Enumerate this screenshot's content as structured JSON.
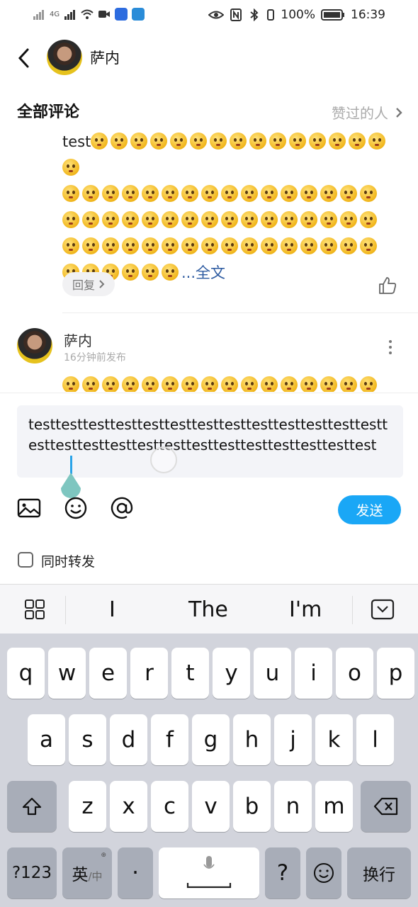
{
  "status_bar": {
    "signal_left": "4G",
    "battery": "100%",
    "time": "16:39"
  },
  "header": {
    "name": "萨内",
    "back_icon": "chevron-left-icon"
  },
  "comments_section": {
    "title": "全部评论",
    "likers_link": "赞过的人"
  },
  "comment1": {
    "text_start": "test",
    "emoji_count_line1": 16,
    "emoji_count_lines": [
      16,
      16,
      16,
      6
    ],
    "full_text_link": "...全文",
    "reply_label": "回复"
  },
  "comment2": {
    "name": "萨内",
    "time": "16分钟前发布"
  },
  "input": {
    "text": "testtesttesttesttesttesttesttesttesttesttesttesttesttesttesttesttesttesttesttesttesttesttesttesttesttest",
    "send_label": "发送",
    "repost_label": "同时转发"
  },
  "keyboard": {
    "suggestions": [
      "I",
      "The",
      "I'm"
    ],
    "row1": [
      "q",
      "w",
      "e",
      "r",
      "t",
      "y",
      "u",
      "i",
      "o",
      "p"
    ],
    "row2": [
      "a",
      "s",
      "d",
      "f",
      "g",
      "h",
      "j",
      "k",
      "l"
    ],
    "row3": [
      "z",
      "x",
      "c",
      "v",
      "b",
      "n",
      "m"
    ],
    "numbers_key": "?123",
    "lang_key": "英",
    "lang_key_sub": "/中",
    "dot_key": "·",
    "question_key": "?",
    "enter_key": "换行"
  },
  "colors": {
    "accent": "#1aa7f6",
    "link": "#2c5aa0"
  }
}
